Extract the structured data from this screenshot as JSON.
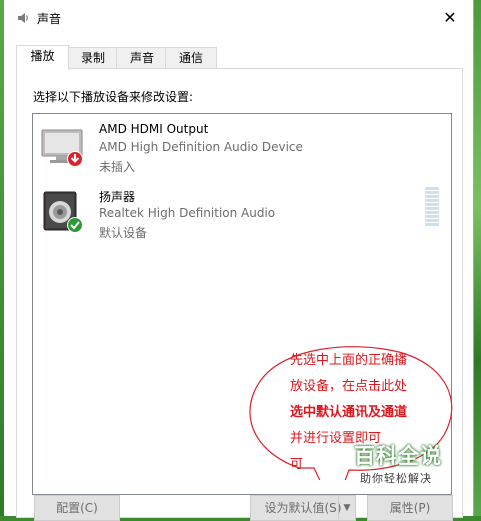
{
  "window": {
    "title": "声音",
    "close_glyph": "✕"
  },
  "tabs": [
    {
      "label": "播放"
    },
    {
      "label": "录制"
    },
    {
      "label": "声音"
    },
    {
      "label": "通信"
    }
  ],
  "instruction": "选择以下播放设备来修改设置:",
  "devices": [
    {
      "name": "AMD HDMI Output",
      "line2": "AMD High Definition Audio Device",
      "line3": "未插入",
      "icon": "monitor-icon",
      "badge": "down-arrow-badge-icon",
      "badge_color": "#d9232b"
    },
    {
      "name": "扬声器",
      "line2": "Realtek High Definition Audio",
      "line3": "默认设备",
      "icon": "speaker-icon",
      "badge": "checkmark-badge-icon",
      "badge_color": "#2d9a3a"
    }
  ],
  "buttons": {
    "configure": "配置(C)",
    "set_default": "设为默认值(S)",
    "properties": "属性(P)"
  },
  "annotation": {
    "lines": [
      {
        "text": "先选中上面的正确播",
        "bold": false
      },
      {
        "text": "放设备，在点击此处",
        "bold": false
      },
      {
        "text": "选中默认通讯及通道",
        "bold": true
      },
      {
        "text": "并进行设置即可",
        "bold": false
      },
      {
        "text": "可",
        "bold": false
      }
    ],
    "color": "#e0161d"
  },
  "watermark": {
    "main": "百科全说",
    "sub": "助你轻松解决"
  }
}
